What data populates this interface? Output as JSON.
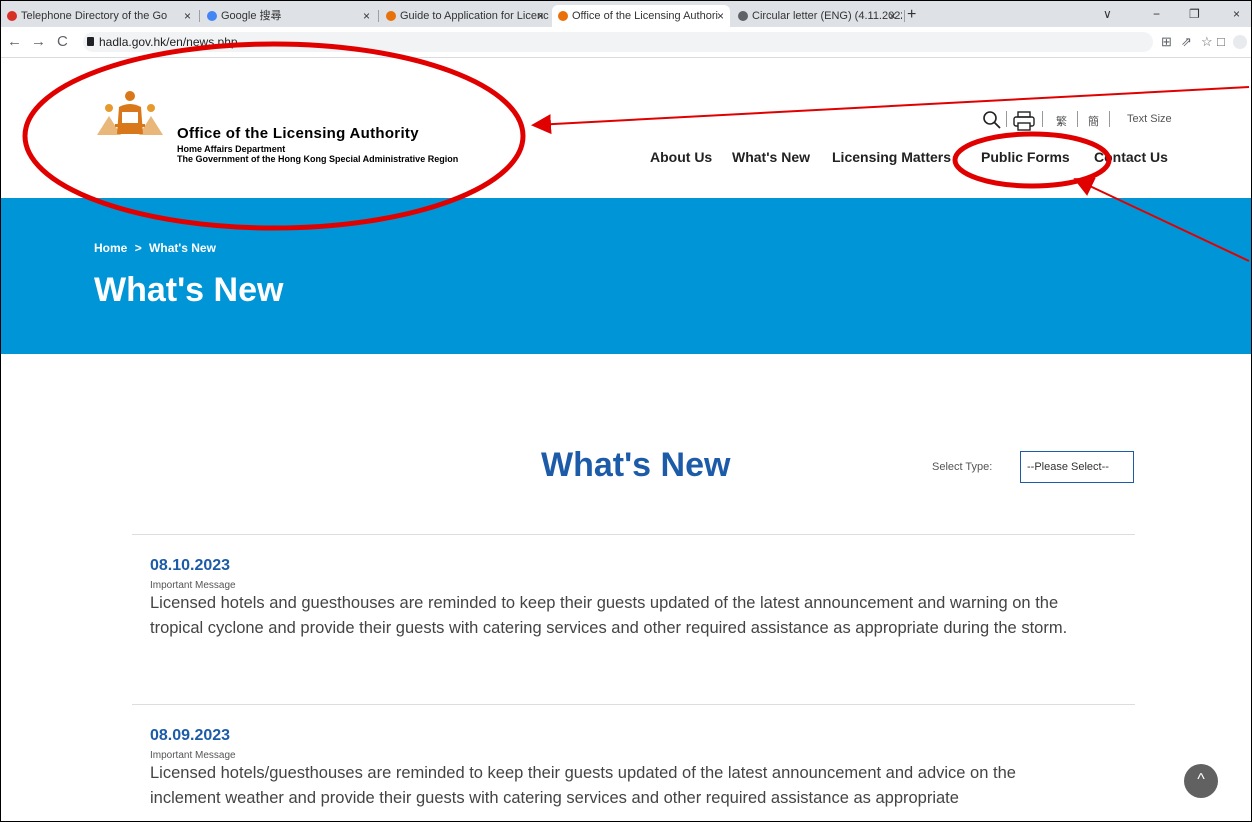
{
  "browser": {
    "tabs": [
      {
        "label": "Telephone Directory of the Go",
        "icon_color": "#d93025",
        "active": false
      },
      {
        "label": "Google 搜尋",
        "icon_color": "#4285f4",
        "active": false
      },
      {
        "label": "Guide to Application for Licenc",
        "icon_color": "#e8710a",
        "active": false
      },
      {
        "label": "Office of the Licensing Authori",
        "icon_color": "#e8710a",
        "active": true
      },
      {
        "label": "Circular letter (ENG) (4.11.2022",
        "icon_color": "#5f6368",
        "active": false
      }
    ],
    "tab_close": "×",
    "new_tab": "+",
    "url": "hadla.gov.hk/en/news.php",
    "back": "←",
    "forward": "→",
    "reload": "C",
    "window_controls": {
      "dropdown": "∨",
      "minimize": "−",
      "restore": "❐",
      "close": "×"
    }
  },
  "header": {
    "org_title": "Office of the Licensing Authority",
    "org_sub1": "Home Affairs Department",
    "org_sub2": "The Government of the Hong Kong Special Administrative Region",
    "utility": {
      "traditional": "繁",
      "simplified": "簡",
      "text_size": "Text Size"
    },
    "nav": [
      "About Us",
      "What's New",
      "Licensing Matters",
      "Public Forms",
      "Contact Us"
    ]
  },
  "banner": {
    "breadcrumb_home": "Home",
    "breadcrumb_sep": ">",
    "breadcrumb_current": "What's New",
    "title": "What's New"
  },
  "content": {
    "title": "What's New",
    "select_label": "Select Type:",
    "select_value": "--Please Select--",
    "news": [
      {
        "date": "08.10.2023",
        "type": "Important Message",
        "text": "Licensed hotels and guesthouses are reminded to keep their guests updated of the latest announcement and warning on the tropical cyclone and provide their guests with catering services and other required assistance as appropriate during the storm."
      },
      {
        "date": "08.09.2023",
        "type": "Important Message",
        "text": "Licensed hotels/guesthouses are reminded to keep their guests updated of the latest announcement and advice on the inclement weather and provide their guests with catering services and other required assistance as appropriate"
      }
    ],
    "back_to_top": "^"
  },
  "colors": {
    "accent_blue": "#1c5ba8",
    "banner_blue": "#0095d6",
    "annotation_red": "#e00000"
  }
}
